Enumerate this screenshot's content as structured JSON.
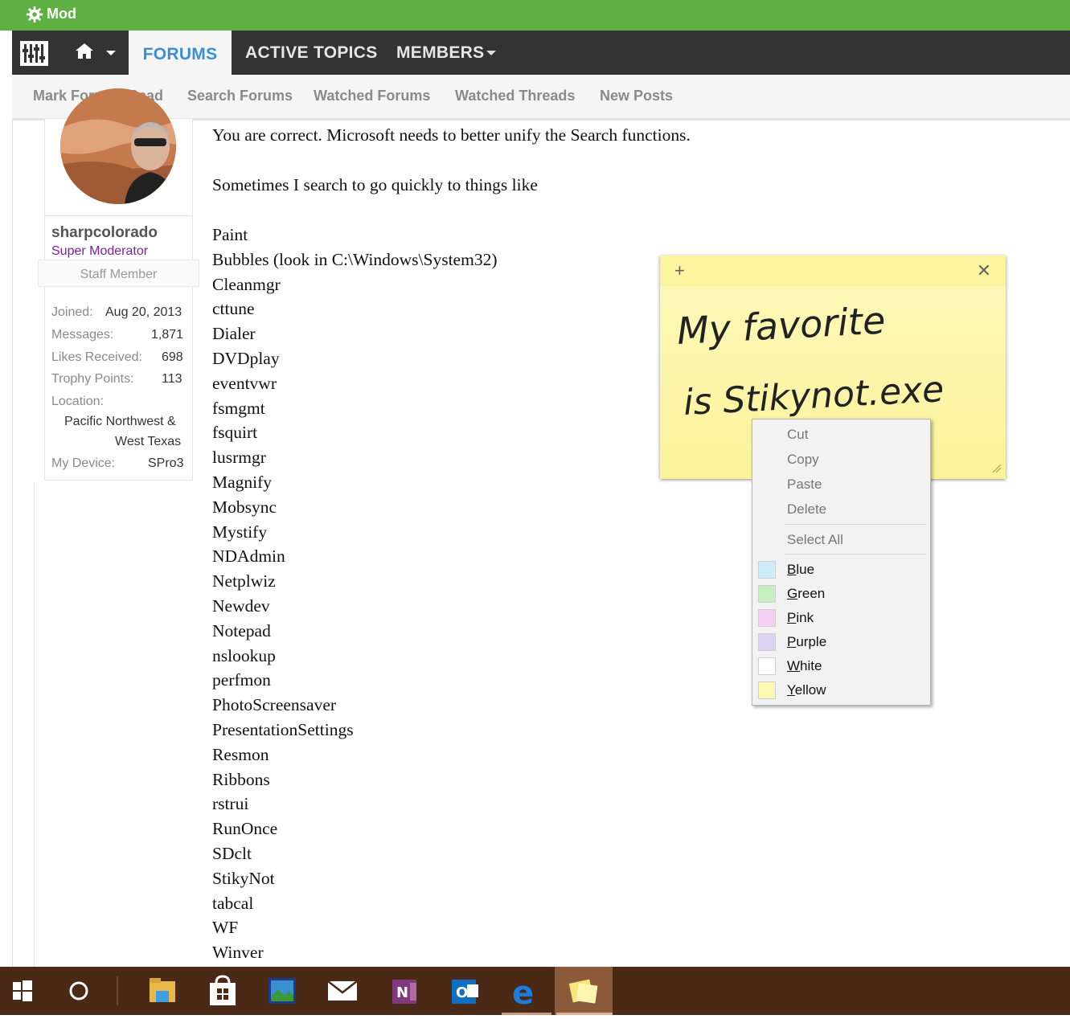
{
  "mod_bar": {
    "label": "Mod"
  },
  "nav": {
    "tabs": [
      "FORUMS",
      "ACTIVE TOPICS",
      "MEMBERS"
    ],
    "active_tab": "FORUMS"
  },
  "subnav": [
    "Mark Forums Read",
    "Search Forums",
    "Watched Forums",
    "Watched Threads",
    "New Posts"
  ],
  "user": {
    "name": "sharpcolorado",
    "role": "Super Moderator",
    "badge": "Staff Member",
    "stats": [
      {
        "label": "Joined:",
        "value": "Aug 20, 2013"
      },
      {
        "label": "Messages:",
        "value": "1,871"
      },
      {
        "label": "Likes Received:",
        "value": "698"
      },
      {
        "label": "Trophy Points:",
        "value": "113"
      }
    ],
    "location_label": "Location:",
    "location_line1": "Pacific Northwest &",
    "location_line2": "West Texas",
    "device_label": "My Device:",
    "device_value": "SPro3"
  },
  "post": {
    "line1": "You are correct. Microsoft needs to better unify the Search functions.",
    "line2": "Sometimes I search to go quickly to things like",
    "items": [
      "Paint",
      "Bubbles (look in C:\\Windows\\System32)",
      "Cleanmgr",
      "cttune",
      "Dialer",
      "DVDplay",
      "eventvwr",
      "fsmgmt",
      "fsquirt",
      "lusrmgr",
      "Magnify",
      "Mobsync",
      "Mystify",
      "NDAdmin",
      "Netplwiz",
      "Newdev",
      "Notepad",
      "nslookup",
      "perfmon",
      "PhotoScreensaver",
      "PresentationSettings",
      "Resmon",
      "Ribbons",
      "rstrui",
      "RunOnce",
      "SDclt",
      "StikyNot",
      "tabcal",
      "WF",
      "Winver"
    ]
  },
  "sticky_note": {
    "handwriting_line1": "My favorite",
    "handwriting_line2": "is  Stikynot.exe",
    "add_icon": "plus-icon",
    "close_icon": "close-icon"
  },
  "context_menu": {
    "edit_items": [
      "Cut",
      "Copy",
      "Paste",
      "Delete"
    ],
    "select_all": "Select All",
    "colors": [
      {
        "label": "Blue",
        "swatch": "#cdeef8"
      },
      {
        "label": "Green",
        "swatch": "#c6f0c2"
      },
      {
        "label": "Pink",
        "swatch": "#f6cdf3"
      },
      {
        "label": "Purple",
        "swatch": "#dcd3f3"
      },
      {
        "label": "White",
        "swatch": "#ffffff"
      },
      {
        "label": "Yellow",
        "swatch": "#fdf8b4"
      }
    ]
  },
  "taskbar": {
    "icons": [
      "windows-start-icon",
      "cortana-icon",
      "file-explorer-icon",
      "store-icon",
      "photo-app-icon",
      "mail-icon",
      "onenote-icon",
      "outlook-icon",
      "edge-icon",
      "sticky-notes-icon"
    ]
  },
  "colors": {
    "mod_green": "#5fb042",
    "nav_dark": "#333333",
    "link_blue": "#3b8ed4",
    "role_purple": "#7b1fa2"
  }
}
